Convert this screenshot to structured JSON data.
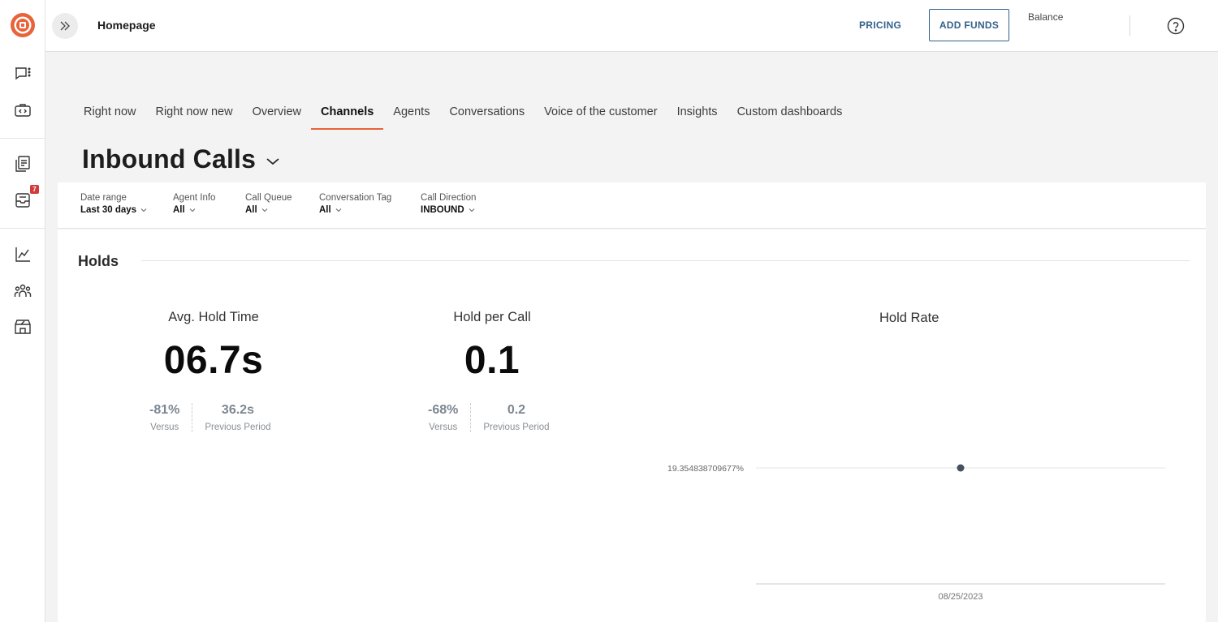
{
  "header": {
    "title": "Homepage",
    "pricing_label": "PRICING",
    "add_funds_label": "ADD FUNDS",
    "balance_label": "Balance"
  },
  "sidebar": {
    "logo": "brand-logo",
    "icons": [
      "chat-icon",
      "code-icon",
      "documents-icon",
      "inbox-icon",
      "analytics-icon",
      "team-icon",
      "store-icon"
    ],
    "inbox_badge": "7",
    "accent_color": "#e8633a"
  },
  "tabs": [
    {
      "label": "Right now"
    },
    {
      "label": "Right now new"
    },
    {
      "label": "Overview"
    },
    {
      "label": "Channels",
      "active": true
    },
    {
      "label": "Agents"
    },
    {
      "label": "Conversations"
    },
    {
      "label": "Voice of the customer"
    },
    {
      "label": "Insights"
    },
    {
      "label": "Custom dashboards"
    }
  ],
  "dashboard": {
    "title": "Inbound Calls"
  },
  "filters": [
    {
      "label": "Date range",
      "value": "Last 30 days"
    },
    {
      "label": "Agent Info",
      "value": "All"
    },
    {
      "label": "Call Queue",
      "value": "All"
    },
    {
      "label": "Conversation Tag",
      "value": "All"
    },
    {
      "label": "Call Direction",
      "value": "INBOUND"
    }
  ],
  "section": {
    "title": "Holds"
  },
  "metrics": [
    {
      "title": "Avg. Hold Time",
      "value": "06.7s",
      "versus": "-81%",
      "versus_label": "Versus",
      "previous": "36.2s",
      "previous_label": "Previous Period"
    },
    {
      "title": "Hold per Call",
      "value": "0.1",
      "versus": "-68%",
      "versus_label": "Versus",
      "previous": "0.2",
      "previous_label": "Previous Period"
    }
  ],
  "chart_data": {
    "type": "scatter",
    "title": "Hold Rate",
    "x": [
      "08/25/2023"
    ],
    "series": [
      {
        "values": [
          19.354838709677
        ]
      }
    ],
    "y_tick_labels": [
      "19.354838709677%"
    ],
    "x_tick_labels": [
      "08/25/2023"
    ],
    "point_color": "#47505c",
    "grid": true,
    "legend": "none"
  }
}
